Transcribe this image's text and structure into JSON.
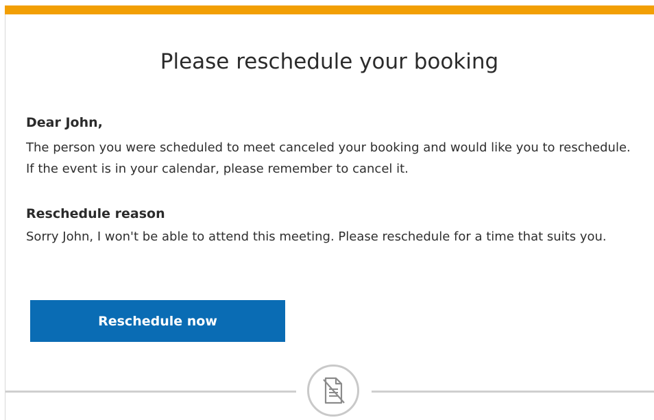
{
  "email": {
    "title": "Please reschedule your booking",
    "greeting": "Dear John,",
    "message": "The person you were scheduled to meet canceled your booking and would like you to reschedule. If the event is in your calendar, please remember to cancel it.",
    "reason_heading": "Reschedule reason",
    "reason_text": "Sorry John, I won't be able to attend this meeting. Please reschedule for a time that suits you.",
    "cta_label": "Reschedule now"
  },
  "colors": {
    "accent_bar": "#f29f05",
    "button": "#0a6cb4",
    "divider": "#cfcfcf"
  },
  "icons": {
    "footer_badge": "document-icon"
  }
}
